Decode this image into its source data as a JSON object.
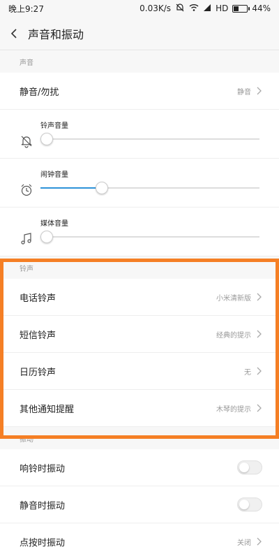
{
  "status_bar": {
    "time": "晚上9:27",
    "net_speed": "0.03K/s",
    "hd": "HD",
    "battery": "44%",
    "battery_level": 0.44
  },
  "header": {
    "title": "声音和振动"
  },
  "sections": {
    "sound": {
      "header": "声音",
      "silent": {
        "label": "静音/勿扰",
        "value": "静音"
      },
      "ringer_volume": {
        "label": "铃声音量",
        "level": 0.02
      },
      "alarm_volume": {
        "label": "闹钟音量",
        "level": 0.28
      },
      "media_volume": {
        "label": "媒体音量",
        "level": 0.02
      }
    },
    "ringtone": {
      "header": "铃声",
      "items": [
        {
          "label": "电话铃声",
          "value": "小米清新版"
        },
        {
          "label": "短信铃声",
          "value": "经典的提示"
        },
        {
          "label": "日历铃声",
          "value": "无"
        },
        {
          "label": "其他通知提醒",
          "value": "木琴的提示"
        }
      ]
    },
    "vibration": {
      "header": "振动",
      "ring_vibrate": {
        "label": "响铃时振动"
      },
      "silent_vibrate": {
        "label": "静音时振动"
      },
      "touch_vibrate": {
        "label": "点按时振动",
        "value": "关闭"
      }
    }
  },
  "colors": {
    "accent": "#2e93d9",
    "highlight": "#f57f25"
  }
}
